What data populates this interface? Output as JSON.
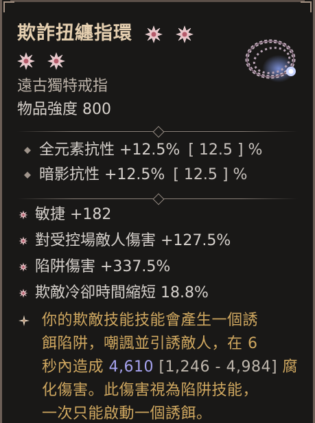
{
  "item": {
    "name": "欺詐扭纏指環",
    "stars_first_line": 2,
    "stars_second_line": 2,
    "type": "遠古獨特戒指",
    "power": "物品強度 800",
    "icon": "twisted-ring-icon"
  },
  "implicits": [
    {
      "text": "全元素抗性 +12.5%",
      "range": "[ 12.5 ] %"
    },
    {
      "text": "暗影抗性 +12.5%",
      "range": "[ 12.5 ] %"
    }
  ],
  "affixes": [
    {
      "text": "敏捷 +182"
    },
    {
      "text": "對受控場敵人傷害 +127.5%"
    },
    {
      "text": "陷阱傷害 +337.5%"
    },
    {
      "text": "欺敵冷卻時間縮短 18.8%"
    }
  ],
  "unique_power": {
    "line1": "你的欺敵技能技能會產生一個誘",
    "line2": "餌陷阱，嘲諷並引誘敵人，在 6",
    "line3_a": "秒內造成 ",
    "line3_value": "4,610",
    "line3_range": " [1,246 - 4,984]",
    "line3_b": " 腐",
    "line4": "化傷害。此傷害視為陷阱技能，",
    "line5": "一次只能啟動一個誘餌。"
  },
  "colors": {
    "title": "#e5cfb0",
    "unique_text": "#d0a860",
    "value_highlight": "#a7a3f0",
    "star": "#e9c4c8"
  }
}
